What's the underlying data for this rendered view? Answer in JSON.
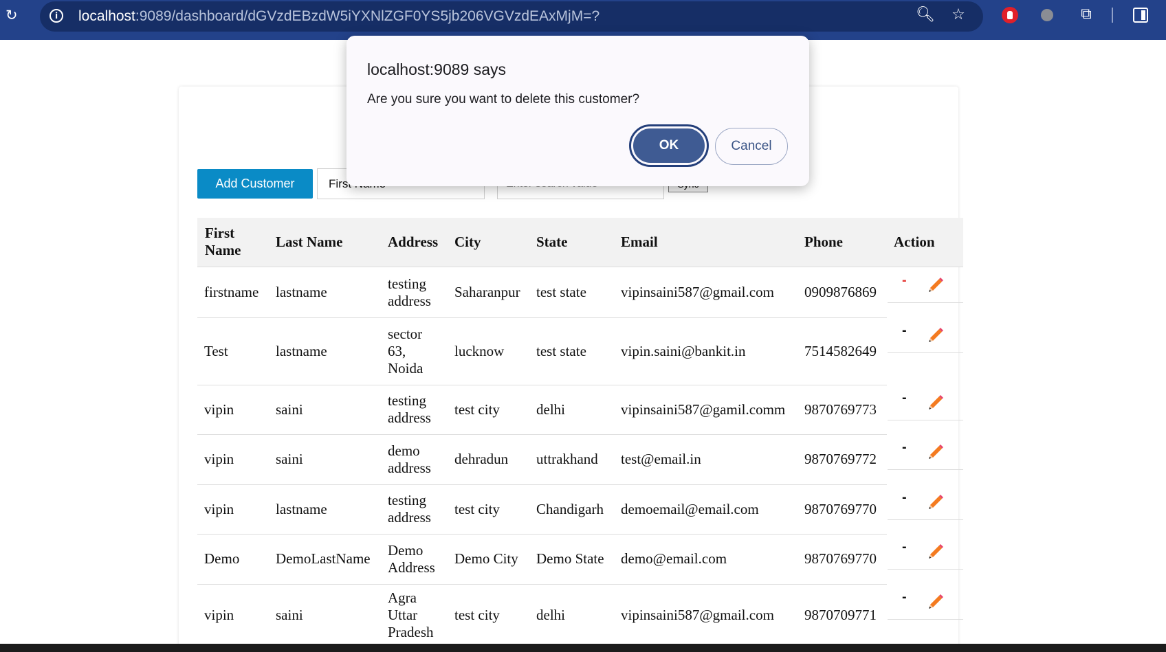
{
  "browser": {
    "url_host": "localhost",
    "url_path": ":9089/dashboard/dGVzdEBzdW5iYXNlZGF0YS5jb206VGVzdEAxMjM=?"
  },
  "toolbar": {
    "add_customer_label": "Add Customer",
    "filter_select_value": "First Name",
    "search_placeholder": "Enter search value",
    "sync_label": "Sync"
  },
  "table": {
    "headers": [
      "First Name",
      "Last Name",
      "Address",
      "City",
      "State",
      "Email",
      "Phone",
      "Action"
    ],
    "rows": [
      {
        "first": "firstname",
        "last": "lastname",
        "address": "testing address",
        "city": "Saharanpur",
        "state": "test state",
        "email": "vipinsaini587@gmail.com",
        "phone": "0909876869",
        "delete": "-"
      },
      {
        "first": "Test",
        "last": "lastname",
        "address": "sector 63, Noida",
        "city": "lucknow",
        "state": "test state",
        "email": "vipin.saini@bankit.in",
        "phone": "7514582649",
        "delete": "-"
      },
      {
        "first": "vipin",
        "last": "saini",
        "address": "testing address",
        "city": "test city",
        "state": "delhi",
        "email": "vipinsaini587@gamil.comm",
        "phone": "9870769773",
        "delete": "-"
      },
      {
        "first": "vipin",
        "last": "saini",
        "address": "demo address",
        "city": "dehradun",
        "state": "uttrakhand",
        "email": "test@email.in",
        "phone": "9870769772",
        "delete": "-"
      },
      {
        "first": "vipin",
        "last": "lastname",
        "address": "testing address",
        "city": "test city",
        "state": "Chandigarh",
        "email": "demoemail@email.com",
        "phone": "9870769770",
        "delete": "-"
      },
      {
        "first": "Demo",
        "last": "DemoLastName",
        "address": "Demo Address",
        "city": "Demo City",
        "state": "Demo State",
        "email": "demo@email.com",
        "phone": "9870769770",
        "delete": "-"
      },
      {
        "first": "vipin",
        "last": "saini",
        "address": "Agra Uttar Pradesh",
        "city": "test city",
        "state": "delhi",
        "email": "vipinsaini587@gmail.com",
        "phone": "9870709771",
        "delete": "-"
      }
    ]
  },
  "dialog": {
    "title": "localhost:9089 says",
    "message": "Are you sure you want to delete this customer?",
    "ok_label": "OK",
    "cancel_label": "Cancel"
  },
  "colors": {
    "chrome_bar": "#23428a",
    "add_button": "#0a8bc6",
    "delete_first_row": "#e53935",
    "pencil": "#f47b20",
    "ok_button": "#3f5b93"
  },
  "icons": [
    "reload-icon",
    "site-info-icon",
    "zoom-icon",
    "bookmark-star-icon",
    "extension-stop-icon",
    "extension-icon",
    "extensions-puzzle-icon",
    "side-panel-icon",
    "delete-icon",
    "pencil-icon"
  ]
}
